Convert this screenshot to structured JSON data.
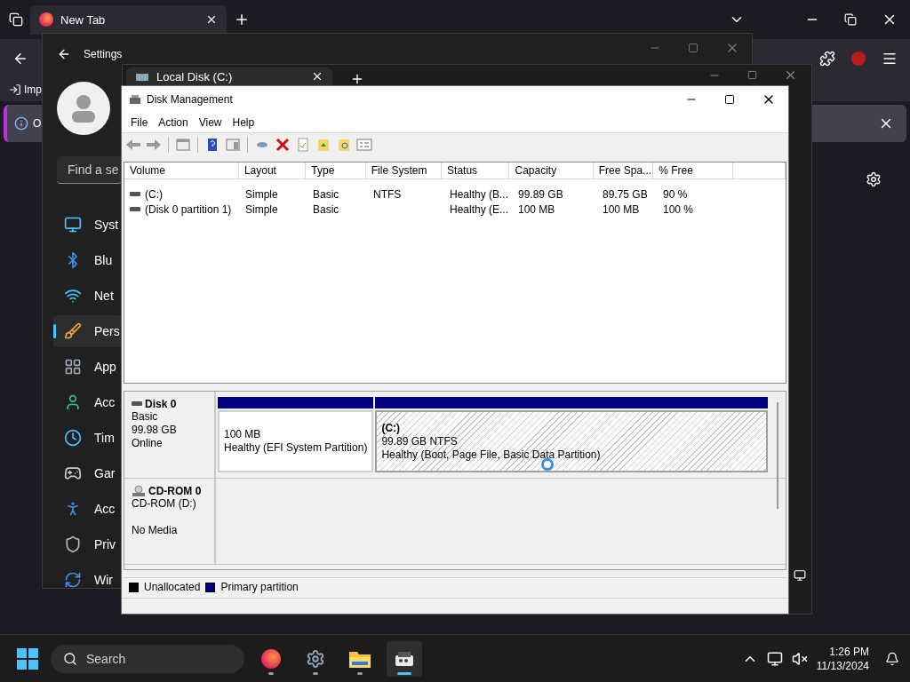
{
  "browser": {
    "tabs": [
      {
        "label": "New Tab",
        "selected": true
      }
    ],
    "bookmark": "Imp",
    "notice": "O"
  },
  "settings": {
    "title": "Settings",
    "search": {
      "placeholder": "Find a se"
    },
    "nav": [
      {
        "label": "Syst",
        "kind": "system",
        "selected": false
      },
      {
        "label": "Blu",
        "kind": "bluetooth",
        "selected": false
      },
      {
        "label": "Net",
        "kind": "network",
        "selected": false
      },
      {
        "label": "Pers",
        "kind": "personalization",
        "selected": true
      },
      {
        "label": "App",
        "kind": "apps",
        "selected": false
      },
      {
        "label": "Acc",
        "kind": "accounts",
        "selected": false
      },
      {
        "label": "Tim",
        "kind": "time",
        "selected": false
      },
      {
        "label": "Gar",
        "kind": "gaming",
        "selected": false
      },
      {
        "label": "Acc",
        "kind": "accessibility",
        "selected": false
      },
      {
        "label": "Priv",
        "kind": "privacy",
        "selected": false
      },
      {
        "label": "Wir",
        "kind": "update",
        "selected": false
      }
    ]
  },
  "explorer": {
    "tab": "Local Disk (C:)"
  },
  "disk_management": {
    "title": "Disk Management",
    "menu": [
      "File",
      "Action",
      "View",
      "Help"
    ],
    "columns": [
      "Volume",
      "Layout",
      "Type",
      "File System",
      "Status",
      "Capacity",
      "Free Spa...",
      "% Free"
    ],
    "rows": [
      [
        "(C:)",
        "Simple",
        "Basic",
        "NTFS",
        "Healthy (B...",
        "99.89 GB",
        "89.75 GB",
        "90 %"
      ],
      [
        "(Disk 0 partition 1)",
        "Simple",
        "Basic",
        "",
        "Healthy (E...",
        "100 MB",
        "100 MB",
        "100 %"
      ]
    ],
    "disks": [
      {
        "kind": "disk",
        "name": "Disk 0",
        "lines": [
          "Basic",
          "99.98 GB",
          "Online"
        ],
        "partitions": [
          {
            "size": "100 MB",
            "status": "Healthy (EFI System Partition)",
            "selected": false
          },
          {
            "label": "(C:)",
            "size": "99.89 GB NTFS",
            "status": "Healthy (Boot, Page File, Basic Data Partition)",
            "selected": true
          }
        ]
      },
      {
        "kind": "cdrom",
        "name": "CD-ROM 0",
        "lines": [
          "CD-ROM (D:)",
          "No Media"
        ]
      }
    ],
    "legend": [
      {
        "label": "Unallocated",
        "color": "#000000"
      },
      {
        "label": "Primary partition",
        "color": "#000080"
      }
    ]
  },
  "taskbar": {
    "search": {
      "placeholder": "Search"
    },
    "apps": [
      {
        "kind": "firefox",
        "selected": false
      },
      {
        "kind": "settings",
        "selected": false
      },
      {
        "kind": "explorer",
        "selected": false
      },
      {
        "kind": "diskmgmt",
        "selected": true
      }
    ],
    "time": "1:26 PM",
    "date": "11/13/2024"
  }
}
